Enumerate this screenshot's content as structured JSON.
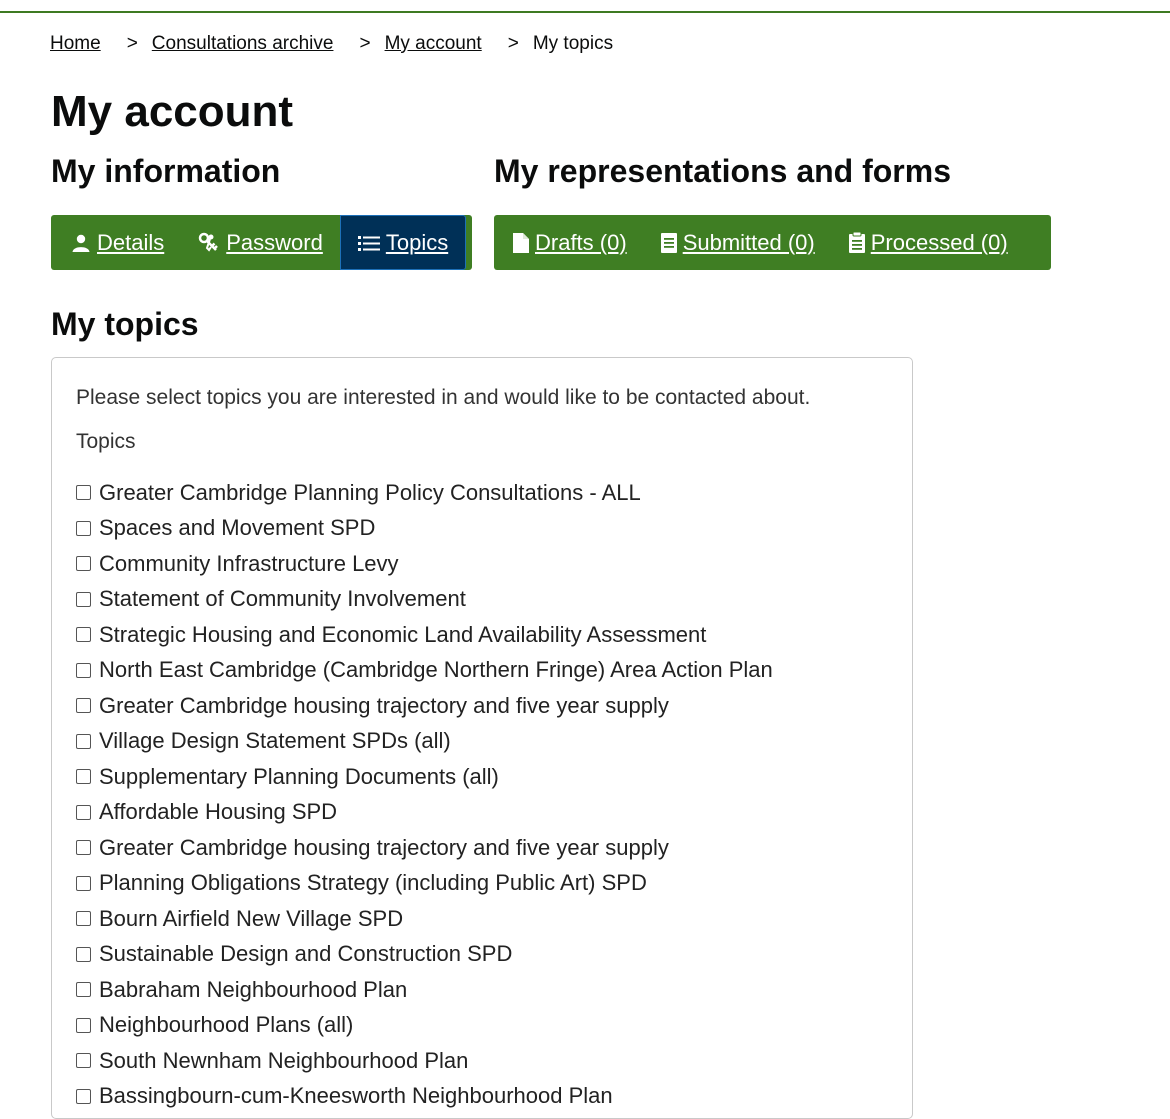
{
  "colors": {
    "nav_green": "#3f7e23",
    "nav_active": "#003057",
    "top_rule": "#3d7a22"
  },
  "breadcrumb": {
    "items": [
      "Home",
      "Consultations archive",
      "My account "
    ],
    "current": "My topics",
    "separator": ">"
  },
  "page_title": "My account",
  "sections": {
    "info_heading": "My information",
    "reps_heading": "My representations and forms",
    "topics_heading": "My topics"
  },
  "info_nav": [
    {
      "label": "Details",
      "icon": "user-icon"
    },
    {
      "label": "Password",
      "icon": "keys-icon"
    },
    {
      "label": "Topics",
      "icon": "list-icon",
      "active": true
    }
  ],
  "reps_nav": [
    {
      "label": "Drafts (0)",
      "icon": "file-icon"
    },
    {
      "label": "Submitted (0)",
      "icon": "document-icon"
    },
    {
      "label": "Processed (0)",
      "icon": "clipboard-icon"
    }
  ],
  "topics_panel": {
    "intro": "Please select topics you are interested in and would like to be contacted about.",
    "label": "Topics",
    "items": [
      "Greater Cambridge Planning Policy Consultations - ALL",
      "Spaces and Movement SPD",
      "Community Infrastructure Levy",
      "Statement of Community Involvement",
      "Strategic Housing and Economic Land Availability Assessment",
      "North East Cambridge (Cambridge Northern Fringe) Area Action Plan",
      "Greater Cambridge housing trajectory and five year supply",
      "Village Design Statement SPDs (all)",
      "Supplementary Planning Documents (all)",
      "Affordable Housing SPD",
      "Greater Cambridge housing trajectory and five year supply",
      "Planning Obligations Strategy (including Public Art) SPD",
      "Bourn Airfield New Village SPD",
      "Sustainable Design and Construction SPD",
      "Babraham Neighbourhood Plan",
      "Neighbourhood Plans (all)",
      "South Newnham Neighbourhood Plan",
      "Bassingbourn-cum-Kneesworth Neighbourhood Plan"
    ]
  }
}
